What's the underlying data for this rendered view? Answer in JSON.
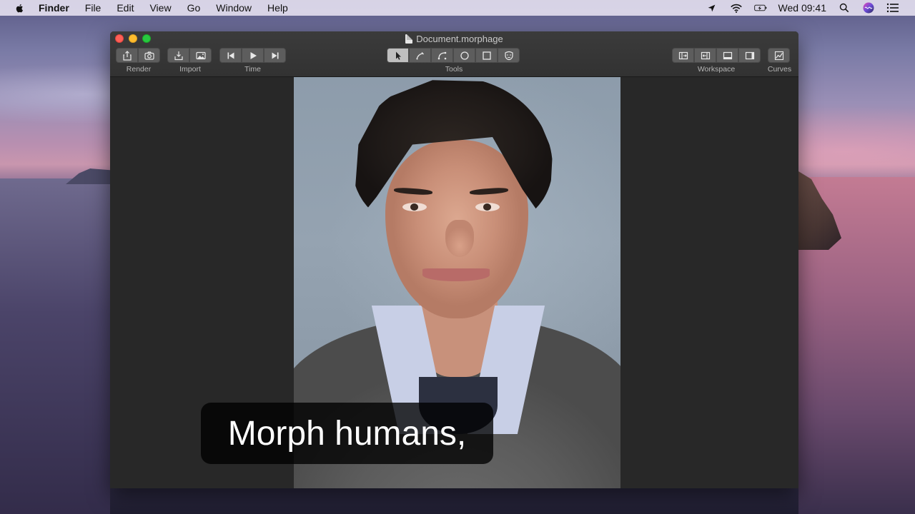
{
  "menubar": {
    "app_name": "Finder",
    "items": [
      "File",
      "Edit",
      "View",
      "Go",
      "Window",
      "Help"
    ],
    "clock": "Wed 09:41"
  },
  "window": {
    "title": "Document.morphage",
    "toolbar": {
      "render_label": "Render",
      "import_label": "Import",
      "time_label": "Time",
      "tools_label": "Tools",
      "workspace_label": "Workspace",
      "curves_label": "Curves"
    }
  },
  "subtitle": "Morph humans,",
  "icons": {
    "render": [
      "share-icon",
      "camera-icon"
    ],
    "import": [
      "import-icon",
      "image-icon"
    ],
    "time": [
      "skip-back-icon",
      "play-icon",
      "skip-forward-icon"
    ],
    "tools": [
      "pointer-icon",
      "pen-icon",
      "curve-icon",
      "circle-icon",
      "square-icon",
      "face-icon"
    ],
    "workspace": [
      "panel-left-icon",
      "panel-left-collapse-icon",
      "panel-bottom-icon",
      "panel-right-icon"
    ],
    "curves": [
      "curves-icon"
    ]
  },
  "colors": {
    "close": "#fe5f57",
    "minimize": "#febc2e",
    "maximize": "#28c840"
  }
}
